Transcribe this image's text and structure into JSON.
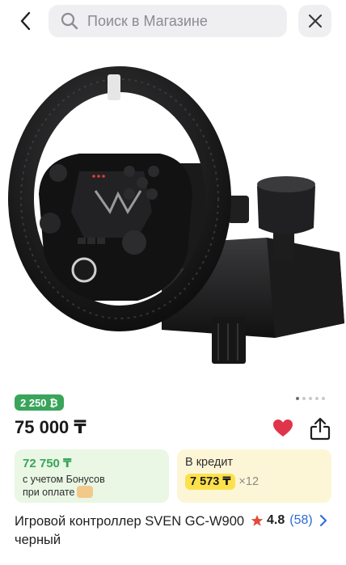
{
  "search": {
    "placeholder": "Поиск в Магазине"
  },
  "icons": {
    "back": "chevron-left-icon",
    "search": "search-icon",
    "close": "close-icon",
    "favorite": "heart-icon",
    "share": "share-icon",
    "rating_star": "star-icon",
    "rating_more": "chevron-right-icon"
  },
  "gallery": {
    "total_images": 5,
    "active_index": 0
  },
  "product": {
    "bonus_badge": "2 250 ₿",
    "price": "75 000 ₸",
    "title": "Игровой контроллер SVEN GC-W900 черный",
    "rating": "4.8",
    "reviews": "(58)",
    "favorited": true
  },
  "bonus_card": {
    "amount": "72 750 ₸",
    "line1": "с учетом Бонусов",
    "line2": "при оплате"
  },
  "credit_card": {
    "title": "В кредит",
    "monthly": "7 573 ₸",
    "months": "×12"
  },
  "colors": {
    "green": "#3aa55a",
    "green_bg": "#e9f7e4",
    "yellow_bg": "#fdf6d6",
    "yellow_pill": "#fde14c",
    "heart": "#e0344b",
    "link_blue": "#2d6ad8",
    "search_bg": "#efeff1"
  }
}
